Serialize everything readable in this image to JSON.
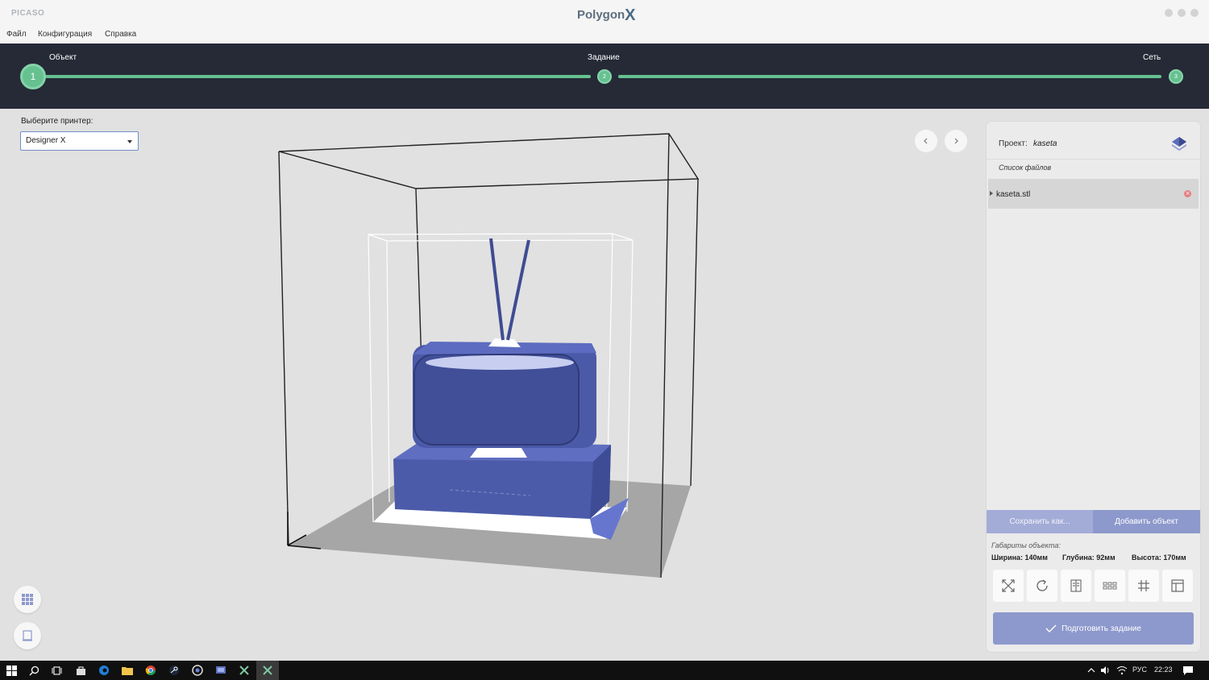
{
  "titlebar": {
    "brand": "PICASO",
    "app_title": "Polygon",
    "app_title_x": "X"
  },
  "menu": {
    "items": [
      "Файл",
      "Конфигурация",
      "Справка"
    ]
  },
  "stepper": {
    "steps": [
      {
        "label": "Объект",
        "number": "1",
        "state": "active"
      },
      {
        "label": "Задание",
        "number": "2",
        "state": "complete"
      },
      {
        "label": "Сеть",
        "number": "3",
        "state": "complete"
      }
    ],
    "accent_color": "#66c190",
    "background_color": "#252a36"
  },
  "printer": {
    "label": "Выберите принтер:",
    "selected": "Designer X"
  },
  "viewport": {
    "model_color": "#4a5aa8"
  },
  "panel": {
    "project_label": "Проект:",
    "project_name": "kaseta",
    "files_title": "Список файлов",
    "files": [
      {
        "name": "kaseta.stl"
      }
    ],
    "save_button": "Сохранить как...",
    "add_button": "Добавить объект",
    "dims_title": "Габариты объекта:",
    "dims": {
      "width": "Ширина: 140мм",
      "depth": "Глубина: 92мм",
      "height": "Высота: 170мм"
    },
    "tools": [
      "scale-icon",
      "rotate-icon",
      "mirror-icon",
      "duplicate-icon",
      "arrange-icon",
      "layout-icon"
    ],
    "prepare_button": "Подготовить задание",
    "button_color": "#8d99cc"
  },
  "taskbar": {
    "language": "РУС",
    "time": "22:23"
  }
}
